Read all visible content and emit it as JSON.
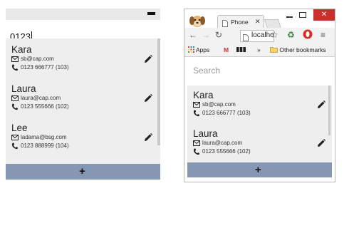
{
  "app": {
    "search_value": "0123",
    "add_button_label": "+",
    "contacts": [
      {
        "name": "Kara",
        "email": "sb@cap.com",
        "phone": "0123 666777 (103)"
      },
      {
        "name": "Laura",
        "email": "laura@cap.com",
        "phone": "0123 555666 (102)"
      },
      {
        "name": "Lee",
        "email": "ladama@bsg.com",
        "phone": "0123 888999 (104)"
      }
    ]
  },
  "browser": {
    "tab_title": "Phone",
    "tab_close": "✕",
    "window_close": "✕",
    "address": "localhost",
    "bookmarks": {
      "apps": "Apps",
      "more": "»",
      "other": "Other bookmarks"
    },
    "page": {
      "search_placeholder": "Search",
      "add_button_label": "+",
      "contacts": [
        {
          "name": "Kara",
          "email": "sb@cap.com",
          "phone": "0123 666777 (103)"
        },
        {
          "name": "Laura",
          "email": "laura@cap.com",
          "phone": "0123 555666 (102)"
        }
      ]
    }
  },
  "colors": {
    "add_bar": "#8597b2",
    "list_background": "#eeeeee",
    "window_close": "#c9302c"
  },
  "icons": [
    "minimize-icon",
    "envelope-icon",
    "phone-icon",
    "pencil-icon",
    "plus-icon",
    "back-arrow-icon",
    "forward-arrow-icon",
    "reload-icon",
    "star-icon",
    "gmail-icon",
    "folder-icon",
    "menu-icon"
  ]
}
